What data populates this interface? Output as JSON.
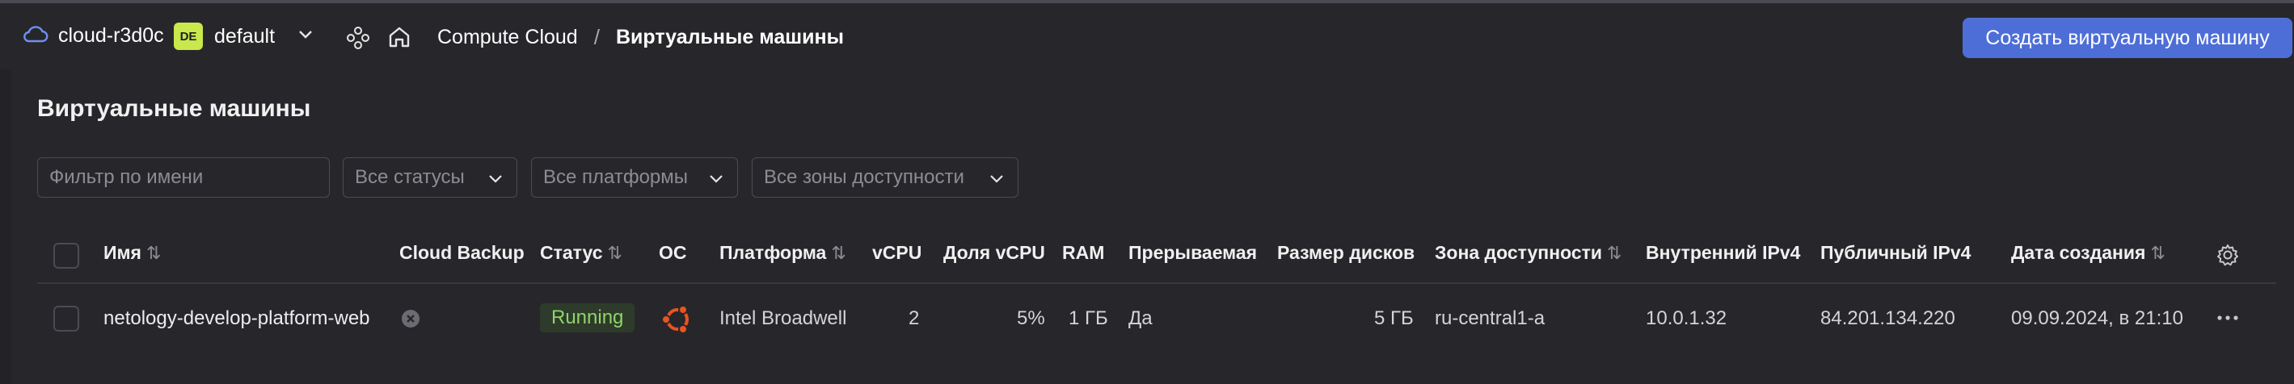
{
  "header": {
    "cloud_name": "cloud-r3d0c",
    "folder_badge": "DE",
    "folder_name": "default",
    "breadcrumb_service": "Compute Cloud",
    "breadcrumb_separator": "/",
    "breadcrumb_current": "Виртуальные машины",
    "create_button": "Создать виртуальную машину"
  },
  "page": {
    "title": "Виртуальные машины"
  },
  "filters": {
    "name_placeholder": "Фильтр по имени",
    "status": "Все статусы",
    "platform": "Все платформы",
    "zone": "Все зоны доступности"
  },
  "table": {
    "columns": {
      "name": "Имя",
      "backup": "Cloud Backup",
      "status": "Статус",
      "os": "ОС",
      "platform": "Платформа",
      "vcpu": "vCPU",
      "vcpu_share": "Доля vCPU",
      "ram": "RAM",
      "preemptible": "Прерываемая",
      "disk_size": "Размер дисков",
      "zone": "Зона доступности",
      "internal_ip": "Внутренний IPv4",
      "public_ip": "Публичный IPv4",
      "created": "Дата создания"
    },
    "rows": [
      {
        "name": "netology-develop-platform-web",
        "status": "Running",
        "os_icon": "ubuntu-icon",
        "platform": "Intel Broadwell",
        "vcpu": "2",
        "vcpu_share": "5%",
        "ram": "1 ГБ",
        "preemptible": "Да",
        "disk_size": "5 ГБ",
        "zone": "ru-central1-a",
        "internal_ip": "10.0.1.32",
        "public_ip": "84.201.134.220",
        "created": "09.09.2024, в 21:10"
      }
    ]
  },
  "colors": {
    "accent": "#4e6ed7",
    "status_running": "#8ed46a",
    "ubuntu": "#e95420",
    "badge": "#c8e84b"
  }
}
